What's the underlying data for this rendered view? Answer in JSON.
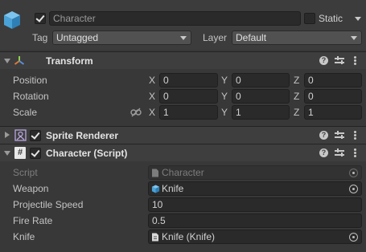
{
  "object": {
    "name": "Character",
    "active": true,
    "static_label": "Static",
    "static_checked": false,
    "tag_label": "Tag",
    "tag_value": "Untagged",
    "layer_label": "Layer",
    "layer_value": "Default"
  },
  "transform": {
    "title": "Transform",
    "rows": [
      {
        "label": "Position",
        "x": "0",
        "y": "0",
        "z": "0"
      },
      {
        "label": "Rotation",
        "x": "0",
        "y": "0",
        "z": "0"
      },
      {
        "label": "Scale",
        "x": "1",
        "y": "1",
        "z": "1"
      }
    ],
    "axis_labels": {
      "x": "X",
      "y": "Y",
      "z": "Z"
    }
  },
  "sprite_renderer": {
    "title": "Sprite Renderer",
    "enabled": true
  },
  "character_script": {
    "title": "Character (Script)",
    "enabled": true,
    "fields": {
      "script_label": "Script",
      "script_value": "Character",
      "weapon_label": "Weapon",
      "weapon_value": "Knife",
      "projectile_speed_label": "Projectile Speed",
      "projectile_speed_value": "10",
      "fire_rate_label": "Fire Rate",
      "fire_rate_value": "0.5",
      "knife_label": "Knife",
      "knife_value": "Knife (Knife)"
    }
  },
  "colors": {
    "background": "#383838",
    "header": "#3e3e3e",
    "field": "#2a2a2a",
    "cube_icon": "#4aa3d8"
  },
  "icons": {
    "game_object": "cube-icon",
    "transform": "transform-axes-icon",
    "sprite_renderer": "sprite-renderer-icon",
    "script": "csharp-script-icon"
  }
}
